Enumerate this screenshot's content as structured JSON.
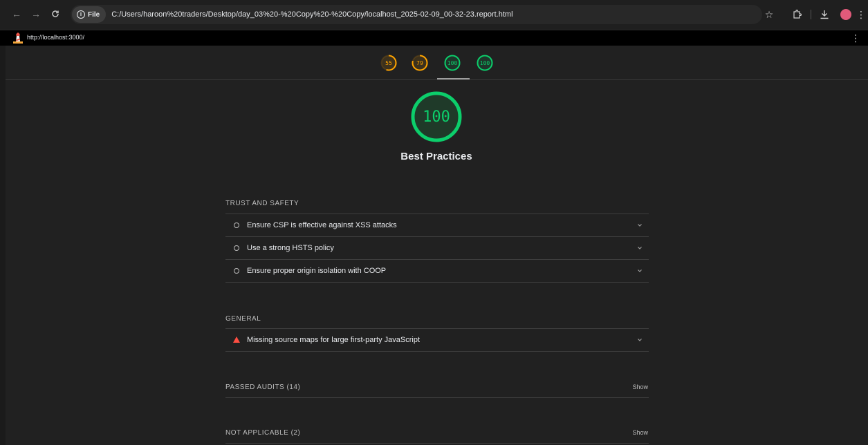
{
  "browser": {
    "file_chip": "File",
    "address": "C:/Users/haroon%20traders/Desktop/day_03%20-%20Copy%20-%20Copy/localhost_2025-02-09_00-32-23.report.html"
  },
  "report": {
    "url": "http://localhost:3000/"
  },
  "scores": [
    {
      "value": "55",
      "color": "#ffa400"
    },
    {
      "value": "79",
      "color": "#ffa400"
    },
    {
      "value": "100",
      "color": "#0cce6b"
    },
    {
      "value": "100",
      "color": "#0cce6b"
    }
  ],
  "category": {
    "score": "100",
    "title": "Best Practices",
    "color": "#0cce6b"
  },
  "groups": {
    "trust": {
      "title": "TRUST AND SAFETY",
      "audits": [
        "Ensure CSP is effective against XSS attacks",
        "Use a strong HSTS policy",
        "Ensure proper origin isolation with COOP"
      ]
    },
    "general": {
      "title": "GENERAL",
      "audits": [
        "Missing source maps for large first-party JavaScript"
      ]
    },
    "passed": {
      "title": "PASSED AUDITS (14)",
      "action": "Show"
    },
    "not_applicable": {
      "title": "NOT APPLICABLE (2)",
      "action": "Show"
    }
  },
  "icons": [
    "back-icon",
    "forward-icon",
    "reload-icon",
    "info-icon",
    "star-icon",
    "extensions-icon",
    "download-icon",
    "kebab-menu-icon",
    "chevron-down-icon",
    "lighthouse-logo"
  ]
}
